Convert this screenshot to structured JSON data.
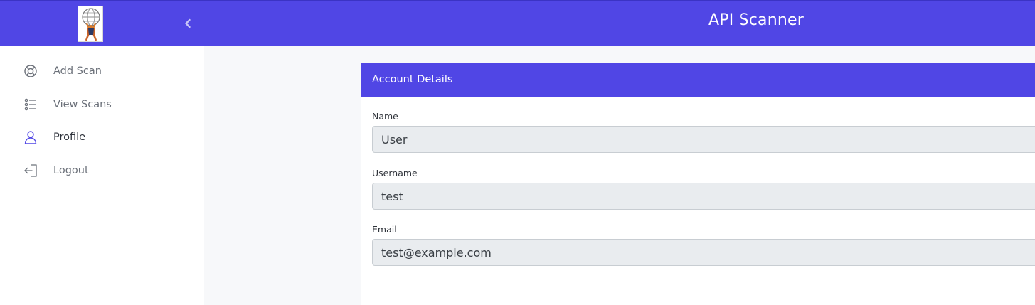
{
  "header": {
    "title": "API Scanner",
    "logo": "atlas-globe-logo",
    "collapse_icon": "chevron-left-icon",
    "color": "#5046e5"
  },
  "sidebar": {
    "items": [
      {
        "label": "Add Scan",
        "icon": "lifebuoy-icon"
      },
      {
        "label": "View Scans",
        "icon": "list-icon"
      },
      {
        "label": "Profile",
        "icon": "user-icon",
        "active": true
      },
      {
        "label": "Logout",
        "icon": "logout-icon"
      }
    ]
  },
  "account": {
    "header": "Account Details",
    "fields": [
      {
        "label": "Name",
        "value": "User"
      },
      {
        "label": "Username",
        "value": "test"
      },
      {
        "label": "Email",
        "value": "test@example.com"
      }
    ]
  }
}
